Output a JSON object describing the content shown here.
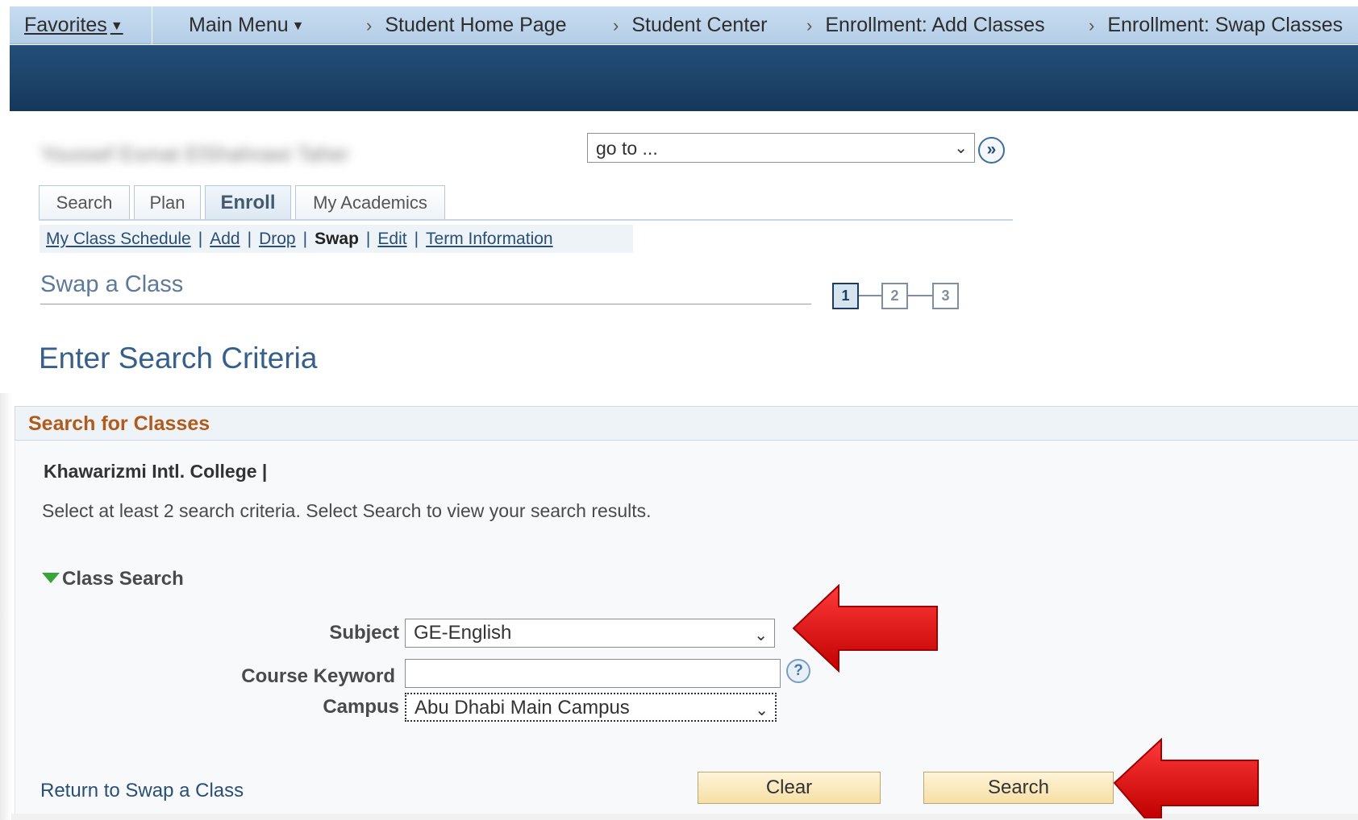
{
  "nav": {
    "favorites": "Favorites",
    "main_menu": "Main Menu",
    "breadcrumbs": [
      "Student Home Page",
      "Student Center",
      "Enrollment: Add Classes",
      "Enrollment: Swap Classes"
    ]
  },
  "student": {
    "name": "Youssef Esmat ElShahrawi Taher"
  },
  "goto": {
    "value": "go to ..."
  },
  "tabs": [
    "Search",
    "Plan",
    "Enroll",
    "My Academics"
  ],
  "subtabs": [
    "My Class Schedule",
    "Add",
    "Drop",
    "Swap",
    "Edit",
    "Term Information"
  ],
  "page": {
    "title": "Swap a Class",
    "steps": [
      "1",
      "2",
      "3"
    ],
    "criteria_title": "Enter Search Criteria"
  },
  "panel": {
    "title": "Search for Classes",
    "college": "Khawarizmi Intl. College |",
    "instructions": "Select at least 2 search criteria. Select Search to view your search results.",
    "section": "Class Search",
    "subject_label": "Subject",
    "subject_value": "GE-English",
    "keyword_label": "Course Keyword",
    "keyword_value": "",
    "campus_label": "Campus",
    "campus_value": "Abu Dhabi Main Campus"
  },
  "actions": {
    "return_link": "Return to Swap a Class",
    "clear": "Clear",
    "search": "Search"
  },
  "colors": {
    "nav_bg": "#c7dcf1",
    "banner": "#1d4268",
    "panel_title": "#b05b1b",
    "link": "#2a4f76",
    "button": "#f6dfa6",
    "annotation_arrow": "#e00000"
  },
  "icons": [
    "chevron-down-icon",
    "breadcrumb-chevron-icon",
    "go-arrow-icon",
    "triangle-down-icon",
    "help-icon",
    "red-arrow-icon"
  ]
}
